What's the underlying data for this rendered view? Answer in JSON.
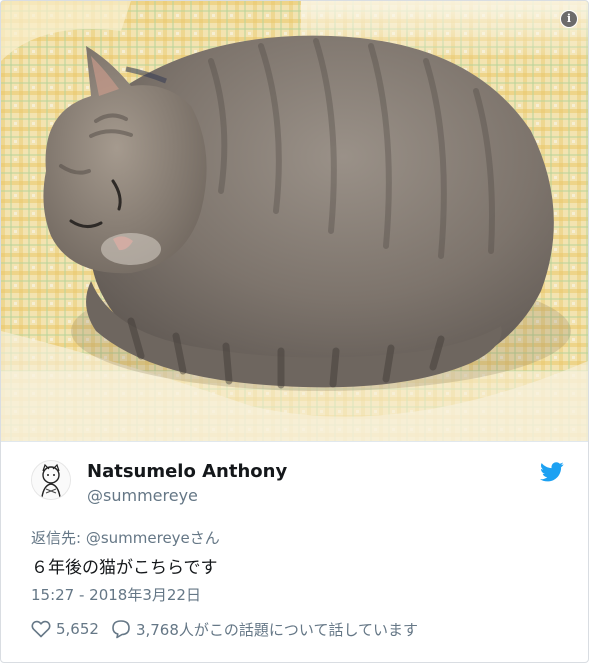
{
  "photo": {
    "subject": "gray tabby cat sleeping curled up on a yellow checkered blanket",
    "info_icon": "info-icon"
  },
  "author": {
    "display_name": "Natsumelo Anthony",
    "handle": "@summereye"
  },
  "tweet": {
    "reply_prefix": "返信先: ",
    "reply_mention": "@summereyeさん",
    "text": "６年後の猫がこちらです",
    "timestamp": "15:27 - 2018年3月22日"
  },
  "actions": {
    "likes": "5,652",
    "replies_text": "3,768人がこの話題について話しています"
  },
  "colors": {
    "twitter_blue": "#1da1f2",
    "text_primary": "#14171a",
    "text_secondary": "#657786",
    "border": "#e1e8ed"
  },
  "icons": [
    "info-icon",
    "twitter-bird-icon",
    "heart-icon",
    "reply-bubble-icon",
    "avatar-drawing"
  ]
}
